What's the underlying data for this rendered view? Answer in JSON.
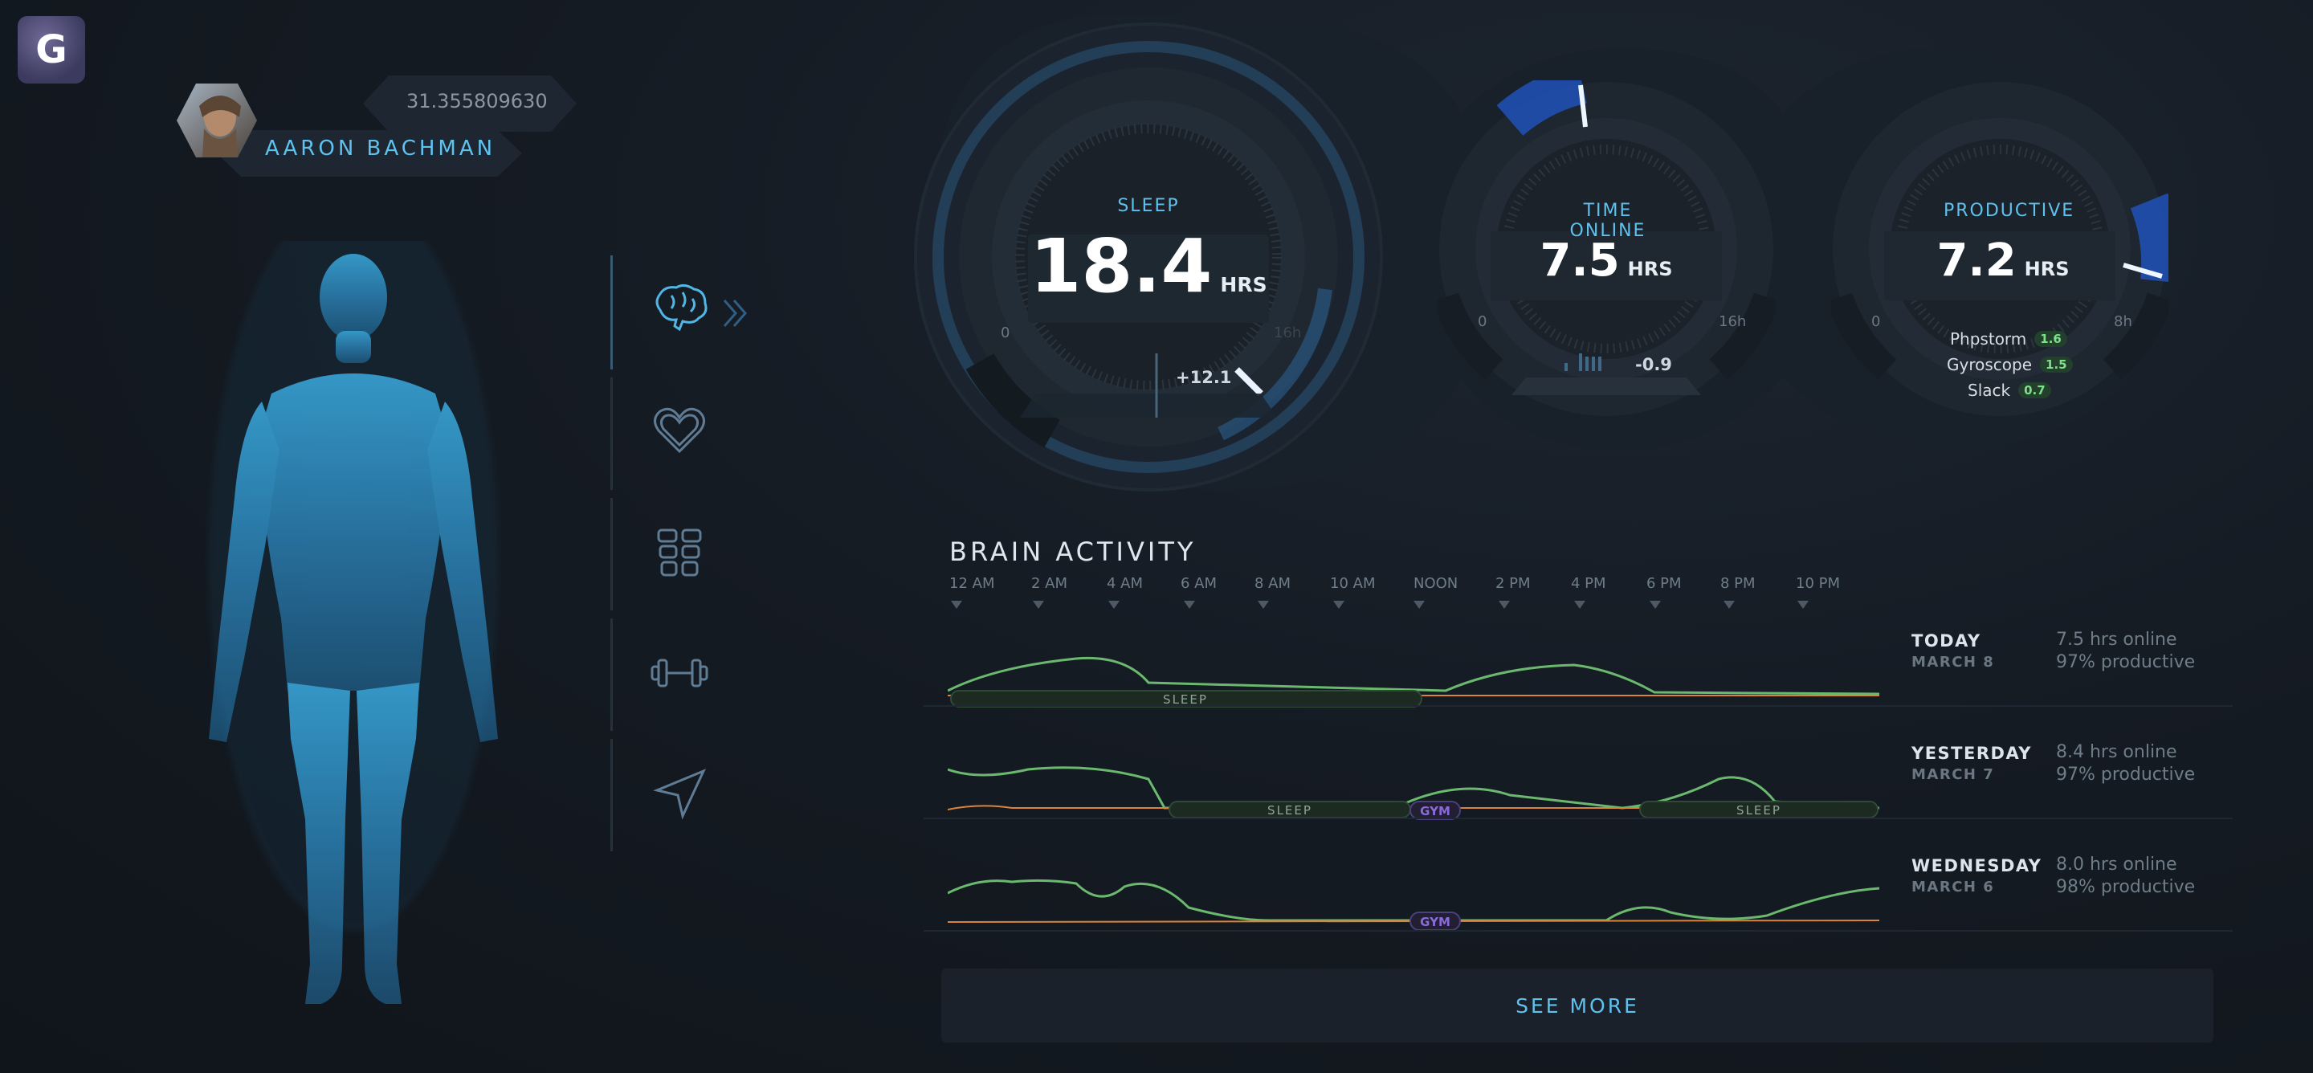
{
  "app": {
    "logo_letter": "G"
  },
  "profile": {
    "name": "AARON BACHMAN",
    "coordinate": "31.355809630"
  },
  "nav": {
    "items": [
      {
        "icon": "brain-icon"
      },
      {
        "icon": "heart-icon"
      },
      {
        "icon": "abs-icon"
      },
      {
        "icon": "dumbbell-icon"
      },
      {
        "icon": "location-arrow-icon"
      }
    ]
  },
  "gauges": {
    "sleep": {
      "label": "SLEEP",
      "value": "18.4",
      "unit": "HRS",
      "min": "0",
      "max": "16h",
      "delta": "+12.1"
    },
    "online": {
      "label": "TIME ONLINE",
      "value": "7.5",
      "unit": "HRS",
      "min": "0",
      "max": "16h",
      "delta": "-0.9"
    },
    "productive": {
      "label": "PRODUCTIVE",
      "value": "7.2",
      "unit": "HRS",
      "min": "0",
      "max": "8h",
      "apps": [
        {
          "name": "Phpstorm",
          "hours": "1.6"
        },
        {
          "name": "Gyroscope",
          "hours": "1.5"
        },
        {
          "name": "Slack",
          "hours": "0.7"
        }
      ]
    }
  },
  "brain_activity": {
    "title": "BRAIN ACTIVITY",
    "times": [
      "12 AM",
      "2 AM",
      "4 AM",
      "6 AM",
      "8 AM",
      "10 AM",
      "NOON",
      "2 PM",
      "4 PM",
      "6 PM",
      "8 PM",
      "10 PM"
    ],
    "days": [
      {
        "day": "TODAY",
        "date": "MARCH 8",
        "online": "7.5 hrs online",
        "productive": "97% productive",
        "tags": [
          "SLEEP"
        ]
      },
      {
        "day": "YESTERDAY",
        "date": "MARCH 7",
        "online": "8.4 hrs online",
        "productive": "97% productive",
        "tags": [
          "SLEEP",
          "GYM",
          "SLEEP"
        ]
      },
      {
        "day": "WEDNESDAY",
        "date": "MARCH 6",
        "online": "8.0 hrs online",
        "productive": "98% productive",
        "tags": [
          "GYM"
        ]
      }
    ],
    "see_more": "SEE MORE",
    "colors": {
      "activity": "#6bb86f",
      "online": "#d9843a",
      "sleep_tag": "#2f4a35",
      "gym_tag": "#8b6bd8"
    }
  }
}
